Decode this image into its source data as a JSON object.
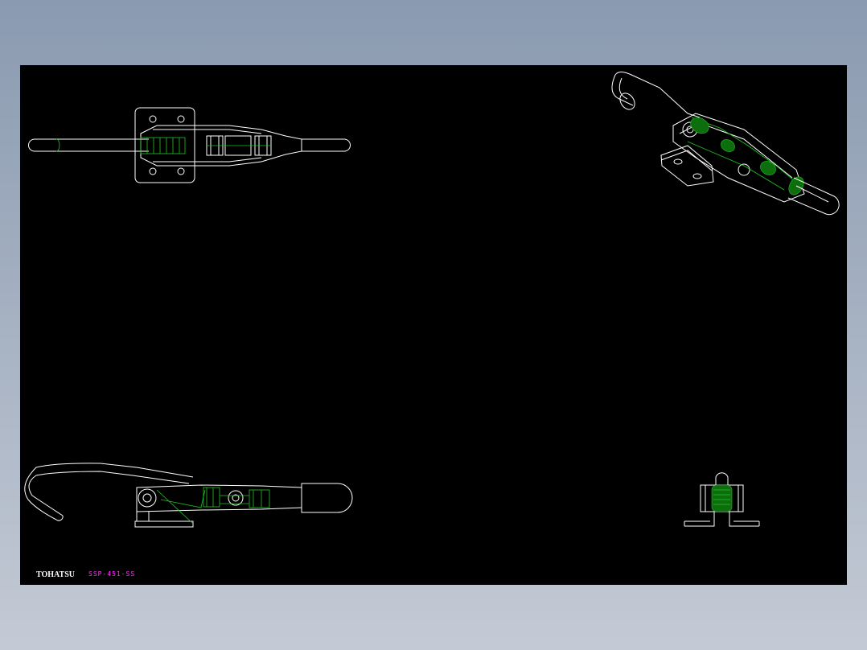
{
  "drawing": {
    "background_color": "#000000",
    "line_color": "#ffffff",
    "hidden_line_color": "#22c322",
    "views": [
      {
        "name": "top-view"
      },
      {
        "name": "isometric-view"
      },
      {
        "name": "side-view"
      },
      {
        "name": "end-view"
      }
    ]
  },
  "title_block": {
    "brand": "TOHATSU",
    "brand_color": "#ffffff",
    "part_number": "SSP-451-SS",
    "part_number_color": "#ff33ff"
  }
}
